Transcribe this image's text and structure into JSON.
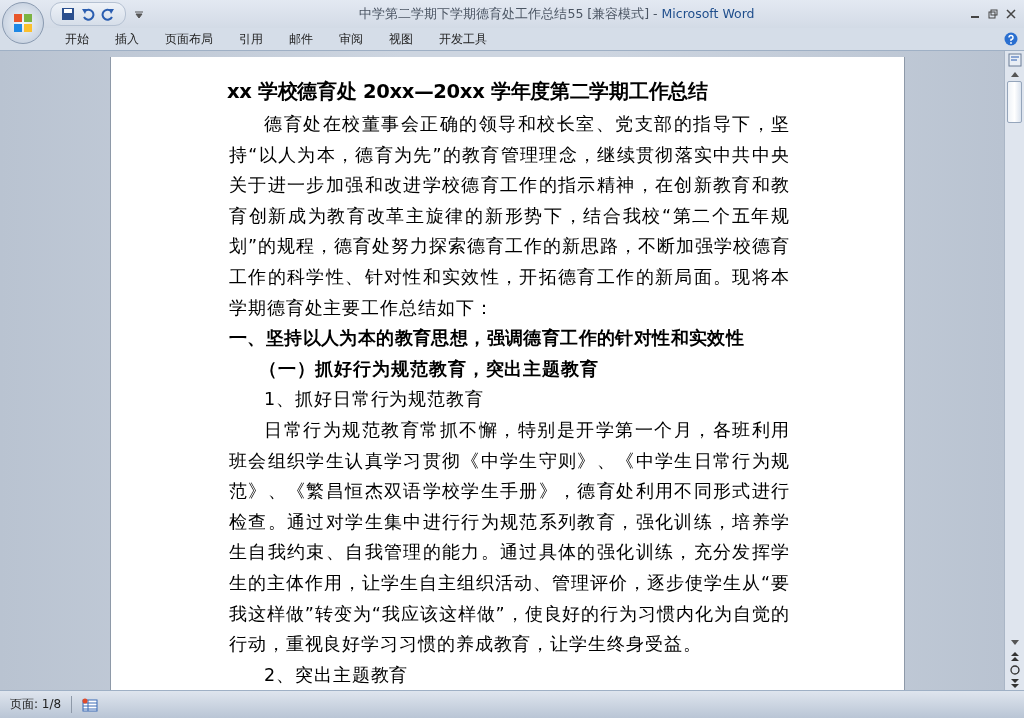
{
  "window": {
    "title": "中学第二学期下学期德育处工作总结55 [兼容模式]",
    "separator": "-",
    "app": "Microsoft Word"
  },
  "ribbon_tabs": [
    {
      "label": "开始",
      "selected": false
    },
    {
      "label": "插入",
      "selected": false
    },
    {
      "label": "页面布局",
      "selected": false
    },
    {
      "label": "引用",
      "selected": false
    },
    {
      "label": "邮件",
      "selected": false
    },
    {
      "label": "审阅",
      "selected": false
    },
    {
      "label": "视图",
      "selected": false
    },
    {
      "label": "开发工具",
      "selected": false
    }
  ],
  "document": {
    "title": "xx 学校德育处 20xx—20xx 学年度第二学期工作总结",
    "paragraphs": [
      {
        "kind": "body",
        "text": "德育处在校董事会正确的领导和校长室、党支部的指导下，坚持“以人为本，德育为先”的教育管理理念，继续贯彻落实中共中央关于进一步加强和改进学校德育工作的指示精神，在创新教育和教育创新成为教育改革主旋律的新形势下，结合我校“第二个五年规划”的规程，德育处努力探索德育工作的新思路，不断加强学校德育工作的科学性、针对性和实效性，开拓德育工作的新局面。现将本学期德育处主要工作总结如下："
      },
      {
        "kind": "heading1",
        "text": "一、坚持以人为本的教育思想，强调德育工作的针对性和实效性"
      },
      {
        "kind": "heading2",
        "text": "（一）抓好行为规范教育，突出主题教育"
      },
      {
        "kind": "item",
        "text": "1、抓好日常行为规范教育"
      },
      {
        "kind": "body",
        "text": "日常行为规范教育常抓不懈，特别是开学第一个月，各班利用班会组织学生认真学习贯彻《中学生守则》、《中学生日常行为规范》、《繁昌恒杰双语学校学生手册》，德育处利用不同形式进行检查。通过对学生集中进行行为规范系列教育，强化训练，培养学生自我约束、自我管理的能力。通过具体的强化训练，充分发挥学生的主体作用，让学生自主组织活动、管理评价，逐步使学生从“要我这样做”转变为“我应该这样做”，使良好的行为习惯内化为自觉的行动，重视良好学习习惯的养成教育，让学生终身受益。"
      },
      {
        "kind": "item",
        "text": "2、突出主题教育"
      }
    ]
  },
  "status_bar": {
    "page": "页面: 1/8"
  }
}
